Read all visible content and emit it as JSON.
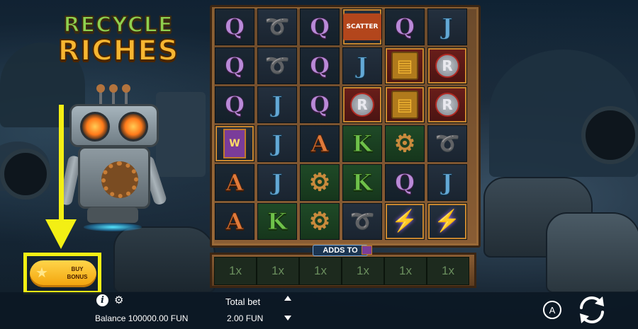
{
  "game": {
    "logo_line1": "RECYCLE",
    "logo_line2": "RICHES"
  },
  "buy_bonus": {
    "label": "BUY BONUS",
    "highlight_color": "#f3ef14"
  },
  "reels": {
    "columns": 6,
    "rows": 6,
    "grid": [
      [
        "Q",
        "rope",
        "Q",
        "scatter",
        "Q",
        "J"
      ],
      [
        "Q",
        "rope",
        "Q",
        "J",
        "book",
        "badge"
      ],
      [
        "Q",
        "J",
        "Q",
        "badge",
        "book",
        "badge"
      ],
      [
        "wild-box",
        "J",
        "A",
        "K",
        "gear",
        "rope"
      ],
      [
        "A",
        "J",
        "gear",
        "K",
        "Q",
        "J"
      ],
      [
        "A",
        "K",
        "gear",
        "rope",
        "spring",
        "spring"
      ]
    ],
    "scatter_text": "SCATTER",
    "badge_letter": "R",
    "wild_letter": "W"
  },
  "adds_to": {
    "label": "ADDS TO",
    "multipliers": [
      "1x",
      "1x",
      "1x",
      "1x",
      "1x",
      "1x"
    ]
  },
  "footer": {
    "balance_text": "Balance 100000.00 FUN",
    "total_bet_label": "Total bet",
    "total_bet_value": "2.00 FUN",
    "autoplay_letter": "A"
  }
}
